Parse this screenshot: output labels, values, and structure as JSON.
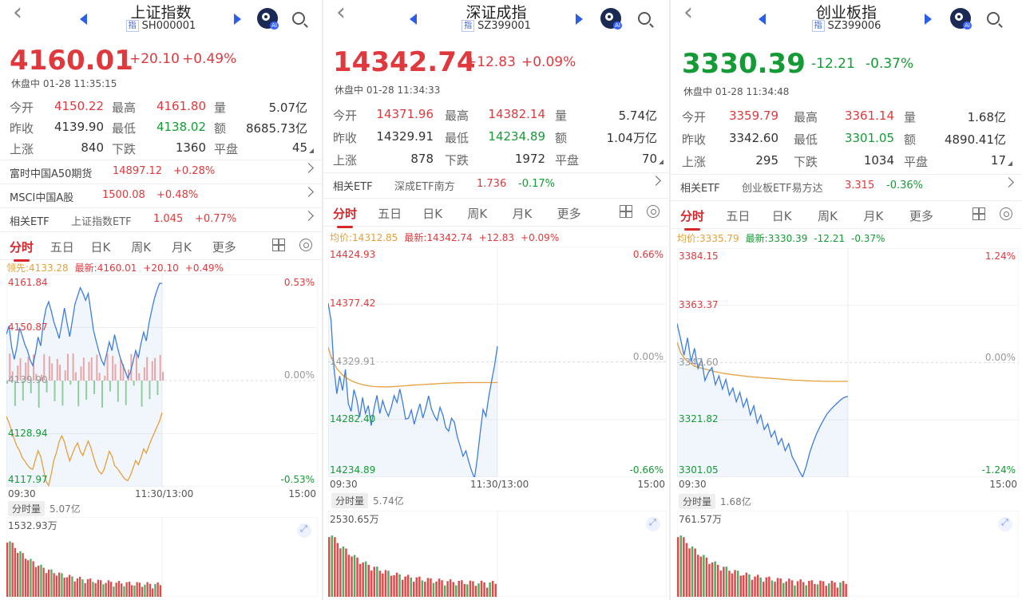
{
  "panels": [
    {
      "title": "上证指数",
      "tag": "指",
      "code": "SH000001",
      "price": "4160.01",
      "change": "+20.10",
      "change_pct": "+0.49%",
      "dir": "up",
      "status": "休盘中 01-28 11:35:15",
      "stats": [
        {
          "l1": "今开",
          "v1": "4150.22",
          "c1": "red",
          "l2": "最高",
          "v2": "4161.80",
          "c2": "red",
          "l3": "量",
          "v3": "5.07亿"
        },
        {
          "l1": "昨收",
          "v1": "4139.90",
          "c1": "gray",
          "l2": "最低",
          "v2": "4138.02",
          "c2": "green",
          "l3": "额",
          "v3": "8685.73亿"
        },
        {
          "l1": "上涨",
          "v1": "840",
          "c1": "gray",
          "l2": "下跌",
          "v2": "1360",
          "c2": "gray",
          "l3": "平盘",
          "v3": "45"
        }
      ],
      "rows": [
        {
          "a": "富时中国A50期货",
          "b": "14897.12",
          "c": "+0.28%"
        },
        {
          "a": "MSCI中国A股",
          "b": "1500.08",
          "c": "+0.48%"
        },
        {
          "a": "相关ETF",
          "b": "上证指数ETF",
          "c": "1.045",
          "d": "+0.77%"
        }
      ],
      "tabs": [
        "分时",
        "五日",
        "日K",
        "周K",
        "月K",
        "更多"
      ],
      "avg_label": "领先:4133.28",
      "latest_label": "最新:4160.01",
      "latest_chg": "+20.10",
      "latest_pct": "+0.49%",
      "y_labels": [
        "4161.84",
        "4150.87",
        "4139.90",
        "4128.94",
        "4117.97"
      ],
      "pct_labels": [
        "0.53%",
        "0.00%",
        "-0.53%"
      ],
      "time_labels": [
        "09:30",
        "11:30/13:00",
        "15:00"
      ],
      "vol_btn": "分时量",
      "vol_total": "5.07亿",
      "vol_max": "1532.93万",
      "chart_data": {
        "type": "line",
        "title": "上证指数",
        "ylim": [
          4117.97,
          4161.84
        ],
        "x_range": [
          "09:30",
          "15:00"
        ],
        "series": [
          {
            "values": [
              4149.5,
              4151.2,
              4146.8,
              4144.3,
              4146.9,
              4150.8,
              4149.2,
              4147.4,
              4146.1,
              4144.2,
              4143.0,
              4145.6,
              4148.9,
              4147.1,
              4151.9,
              4154.8,
              4156.2,
              4154.3,
              4152.0,
              4150.4,
              4148.6,
              4151.7,
              4154.9,
              4151.8,
              4149.0,
              4152.3,
              4155.7,
              4157.4,
              4159.1,
              4158.0,
              4156.5,
              4157.9,
              4154.2,
              4150.3,
              4148.1,
              4146.0,
              4144.2,
              4143.1,
              4145.5,
              4147.9,
              4146.1,
              4149.4,
              4147.0,
              4144.9,
              4143.3,
              4141.9,
              4140.4,
              4141.6,
              4143.8,
              4146.1,
              4144.7,
              4147.6,
              4149.9,
              4148.1,
              4151.7,
              4154.3,
              4156.7,
              4158.5,
              4160.0,
              4160.01
            ]
          },
          {
            "values": [
              4132.5,
              4131.2,
              4129.5,
              4127.8,
              4126.3,
              4125.4,
              4124.0,
              4123.3,
              4122.4,
              4121.8,
              4121.6,
              4123.6,
              4125.4,
              4124.2,
              4121.6,
              4119.1,
              4118.2,
              4120.6,
              4123.5,
              4125.1,
              4127.3,
              4128.5,
              4127.2,
              4125.1,
              4123.3,
              4124.7,
              4126.1,
              4127.0,
              4125.3,
              4124.4,
              4126.0,
              4127.4,
              4126.0,
              4124.1,
              4122.3,
              4121.2,
              4120.6,
              4121.5,
              4123.4,
              4125.3,
              4124.3,
              4122.3,
              4121.8,
              4121.0,
              4120.2,
              4119.5,
              4119.2,
              4120.3,
              4121.8,
              4123.4,
              4122.5,
              4124.0,
              4125.8,
              4124.9,
              4126.4,
              4127.8,
              4129.0,
              4130.3,
              4131.5,
              4133.28
            ]
          }
        ]
      }
    },
    {
      "title": "深证成指",
      "tag": "指",
      "code": "SZ399001",
      "price": "14342.74",
      "change": "+12.83",
      "change_pct": "+0.09%",
      "dir": "up",
      "status": "休盘中 01-28 11:34:33",
      "stats": [
        {
          "l1": "今开",
          "v1": "14371.96",
          "c1": "red",
          "l2": "最高",
          "v2": "14382.14",
          "c2": "red",
          "l3": "量",
          "v3": "5.74亿"
        },
        {
          "l1": "昨收",
          "v1": "14329.91",
          "c1": "gray",
          "l2": "最低",
          "v2": "14234.89",
          "c2": "green",
          "l3": "额",
          "v3": "1.04万亿"
        },
        {
          "l1": "上涨",
          "v1": "878",
          "c1": "gray",
          "l2": "下跌",
          "v2": "1972",
          "c2": "gray",
          "l3": "平盘",
          "v3": "70"
        }
      ],
      "rows": [
        {
          "a": "相关ETF",
          "b": "深成ETF南方",
          "c": "1.736",
          "d": "-0.17%"
        }
      ],
      "tabs": [
        "分时",
        "五日",
        "日K",
        "周K",
        "月K",
        "更多"
      ],
      "avg_label": "均价:14312.85",
      "latest_label": "最新:14342.74",
      "latest_chg": "+12.83",
      "latest_pct": "+0.09%",
      "y_labels": [
        "14424.93",
        "14377.42",
        "14329.91",
        "14282.40",
        "14234.89"
      ],
      "pct_labels": [
        "0.66%",
        "0.00%",
        "-0.66%"
      ],
      "time_labels": [
        "09:30",
        "11:30/13:00",
        "15:00"
      ],
      "vol_btn": "分时量",
      "vol_total": "5.74亿",
      "vol_max": "2530.65万",
      "chart_data": {
        "type": "line",
        "title": "深证成指",
        "ylim": [
          14234.89,
          14424.93
        ],
        "x_range": [
          "09:30",
          "15:00"
        ],
        "series": [
          {
            "values": [
              14378.2,
              14364.3,
              14325.5,
              14303.6,
              14318.3,
              14306.3,
              14323.7,
              14295.6,
              14289.0,
              14307.0,
              14298.5,
              14284.5,
              14300.5,
              14287.3,
              14293.9,
              14277.4,
              14291.7,
              14302.3,
              14287.3,
              14298.0,
              14290.3,
              14285.1,
              14292.7,
              14302.1,
              14296.4,
              14307.5,
              14296.2,
              14282.7,
              14283.5,
              14290.2,
              14278.5,
              14287.5,
              14295.3,
              14283.6,
              14291.7,
              14301.8,
              14291.1,
              14285.6,
              14281.5,
              14292.5,
              14286.2,
              14275.6,
              14272.8,
              14283.4,
              14280.1,
              14268.3,
              14260.4,
              14252.1,
              14256.6,
              14247.6,
              14240.0,
              14233.9,
              14250.6,
              14271.3,
              14290.7,
              14285.0,
              14301.4,
              14314.5,
              14326.8,
              14342.74
            ]
          },
          {
            "values": [
              14342.0,
              14334.2,
              14328.8,
              14324.4,
              14321.7,
              14319.0,
              14317.4,
              14315.7,
              14314.4,
              14313.4,
              14312.5,
              14311.8,
              14311.1,
              14310.6,
              14310.2,
              14309.8,
              14309.6,
              14309.5,
              14309.3,
              14309.3,
              14309.2,
              14309.3,
              14309.4,
              14309.5,
              14309.7,
              14309.9,
              14310.1,
              14310.2,
              14310.4,
              14310.7,
              14310.7,
              14310.9,
              14311.1,
              14311.2,
              14311.3,
              14311.5,
              14311.6,
              14311.7,
              14311.9,
              14312.0,
              14312.2,
              14312.3,
              14312.4,
              14312.5,
              14312.6,
              14312.7,
              14312.7,
              14312.7,
              14312.8,
              14312.8,
              14312.8,
              14312.8,
              14312.8,
              14312.8,
              14312.8,
              14312.8,
              14312.8,
              14312.8,
              14312.8,
              14312.85
            ]
          }
        ]
      }
    },
    {
      "title": "创业板指",
      "tag": "指",
      "code": "SZ399006",
      "price": "3330.39",
      "change": "-12.21",
      "change_pct": "-0.37%",
      "dir": "down",
      "status": "休盘中 01-28 11:34:48",
      "stats": [
        {
          "l1": "今开",
          "v1": "3359.79",
          "c1": "red",
          "l2": "最高",
          "v2": "3361.14",
          "c2": "red",
          "l3": "量",
          "v3": "1.68亿"
        },
        {
          "l1": "昨收",
          "v1": "3342.60",
          "c1": "gray",
          "l2": "最低",
          "v2": "3301.05",
          "c2": "green",
          "l3": "额",
          "v3": "4890.41亿"
        },
        {
          "l1": "上涨",
          "v1": "295",
          "c1": "gray",
          "l2": "下跌",
          "v2": "1034",
          "c2": "gray",
          "l3": "平盘",
          "v3": "17"
        }
      ],
      "rows": [
        {
          "a": "相关ETF",
          "b": "创业板ETF易方达",
          "c": "3.315",
          "d": "-0.36%"
        }
      ],
      "tabs": [
        "分时",
        "五日",
        "日K",
        "周K",
        "月K",
        "更多"
      ],
      "avg_label": "均价:3335.79",
      "latest_label": "最新:3330.39",
      "latest_chg": "-12.21",
      "latest_pct": "-0.37%",
      "y_labels": [
        "3384.15",
        "3363.37",
        "3342.60",
        "3321.82",
        "3301.05"
      ],
      "pct_labels": [
        "1.24%",
        "0.00%",
        "-1.24%"
      ],
      "time_labels": [
        "09:30",
        "15:00"
      ],
      "vol_btn": "分时量",
      "vol_total": "1.68亿",
      "vol_max": "761.57万",
      "chart_data": {
        "type": "line",
        "title": "创业板指",
        "ylim": [
          3301.05,
          3384.15
        ],
        "x_range": [
          "09:30",
          "15:00"
        ],
        "series": [
          {
            "values": [
              3356.8,
              3351.2,
              3345.3,
              3351.6,
              3342.9,
              3347.8,
              3340.5,
              3343.8,
              3336.1,
              3339.1,
              3340.8,
              3334.6,
              3337.8,
              3333.0,
              3336.5,
              3330.8,
              3333.4,
              3328.4,
              3331.8,
              3326.5,
              3329.5,
              3323.6,
              3326.9,
              3320.7,
              3323.6,
              3318.3,
              3320.4,
              3315.6,
              3317.8,
              3312.9,
              3315.1,
              3310.6,
              3313.2,
              3308.5,
              3306.1,
              3303.4,
              3301.05,
              3304.9,
              3309.8,
              3313.5,
              3316.8,
              3319.5,
              3321.8,
              3324.0,
              3325.5,
              3326.8,
              3328.0,
              3329.2,
              3330.0,
              3330.39
            ]
          },
          {
            "values": [
              3350.0,
              3346.2,
              3344.4,
              3343.1,
              3342.2,
              3341.3,
              3340.9,
              3340.6,
              3340.3,
              3339.9,
              3339.6,
              3339.3,
              3339.0,
              3338.8,
              3338.6,
              3338.4,
              3338.2,
              3338.1,
              3337.9,
              3337.8,
              3337.6,
              3337.5,
              3337.4,
              3337.3,
              3337.2,
              3337.1,
              3337.0,
              3336.9,
              3336.8,
              3336.7,
              3336.6,
              3336.5,
              3336.4,
              3336.3,
              3336.2,
              3336.2,
              3336.1,
              3336.0,
              3336.0,
              3335.9,
              3335.9,
              3335.9,
              3335.8,
              3335.8,
              3335.8,
              3335.8,
              3335.8,
              3335.8,
              3335.8,
              3335.79
            ]
          }
        ]
      }
    }
  ]
}
